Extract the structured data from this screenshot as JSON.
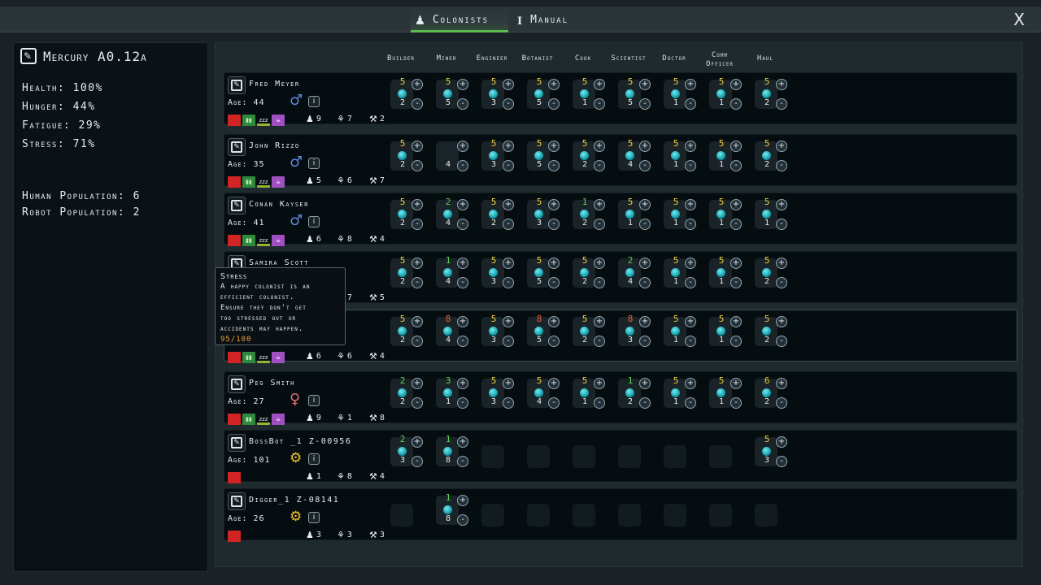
{
  "top": {
    "tabs": [
      {
        "label": "Colonists",
        "icon": "colonist-icon"
      },
      {
        "label": "Manual",
        "icon": "info-icon"
      }
    ],
    "close_label": "X"
  },
  "colony": {
    "name": "Mercury A0.12a",
    "health": "Health: 100%",
    "hunger": "Hunger: 44%",
    "fatigue": "Fatigue: 29%",
    "stress": "Stress: 71%",
    "human_population": "Human Population: 6",
    "robot_population": "Robot Population: 2"
  },
  "jobs": [
    "Builder",
    "Miner",
    "Engineer",
    "Botanist",
    "Cook",
    "Scientist",
    "Doctor",
    "Comm Officer",
    "Haul"
  ],
  "colonists": [
    {
      "name": "Fred Meyer",
      "age": "Age: 44",
      "gender": "♂",
      "gtype": "male",
      "stats": [
        "9",
        "7",
        "2"
      ],
      "skills": [
        [
          "5",
          "2",
          "y"
        ],
        [
          "5",
          "5",
          "y"
        ],
        [
          "5",
          "3",
          "y"
        ],
        [
          "5",
          "5",
          "y"
        ],
        [
          "5",
          "1",
          "y"
        ],
        [
          "5",
          "5",
          "y"
        ],
        [
          "5",
          "1",
          "y"
        ],
        [
          "5",
          "1",
          "y"
        ],
        [
          "5",
          "2",
          "y"
        ]
      ]
    },
    {
      "name": "John Rizzo",
      "age": "Age: 35",
      "gender": "♂",
      "gtype": "male",
      "stats": [
        "5",
        "6",
        "7"
      ],
      "skills": [
        [
          "5",
          "2",
          "y"
        ],
        [
          "",
          "4",
          "e"
        ],
        [
          "5",
          "3",
          "y"
        ],
        [
          "5",
          "5",
          "y"
        ],
        [
          "5",
          "2",
          "y"
        ],
        [
          "5",
          "4",
          "y"
        ],
        [
          "5",
          "1",
          "y"
        ],
        [
          "5",
          "1",
          "y"
        ],
        [
          "5",
          "2",
          "y"
        ]
      ]
    },
    {
      "name": "Conan Kayser",
      "age": "Age: 41",
      "gender": "♂",
      "gtype": "male",
      "stats": [
        "6",
        "8",
        "4"
      ],
      "skills": [
        [
          "5",
          "2",
          "y"
        ],
        [
          "2",
          "4",
          "g"
        ],
        [
          "5",
          "2",
          "y"
        ],
        [
          "5",
          "3",
          "y"
        ],
        [
          "1",
          "2",
          "g"
        ],
        [
          "5",
          "1",
          "y"
        ],
        [
          "5",
          "1",
          "y"
        ],
        [
          "5",
          "1",
          "y"
        ],
        [
          "5",
          "1",
          "y"
        ]
      ]
    },
    {
      "name": "Samira Scott",
      "age": "",
      "gender": "",
      "gtype": "none",
      "stats": [
        "",
        "7",
        "5"
      ],
      "skills": [
        [
          "5",
          "2",
          "y"
        ],
        [
          "1",
          "4",
          "g"
        ],
        [
          "5",
          "3",
          "y"
        ],
        [
          "5",
          "5",
          "y"
        ],
        [
          "5",
          "2",
          "y"
        ],
        [
          "2",
          "4",
          "g"
        ],
        [
          "5",
          "1",
          "y"
        ],
        [
          "5",
          "1",
          "y"
        ],
        [
          "5",
          "2",
          "y"
        ]
      ]
    },
    {
      "name": "",
      "age": "",
      "gender": "",
      "gtype": "none",
      "stats": [
        "6",
        "6",
        "4"
      ],
      "skills": [
        [
          "5",
          "2",
          "y"
        ],
        [
          "8",
          "4",
          "r"
        ],
        [
          "5",
          "3",
          "y"
        ],
        [
          "8",
          "5",
          "r"
        ],
        [
          "5",
          "2",
          "y"
        ],
        [
          "8",
          "3",
          "r"
        ],
        [
          "5",
          "1",
          "y"
        ],
        [
          "5",
          "1",
          "y"
        ],
        [
          "5",
          "2",
          "y"
        ]
      ]
    },
    {
      "name": "Peg Smith",
      "age": "Age: 27",
      "gender": "♀",
      "gtype": "female",
      "stats": [
        "9",
        "1",
        "8"
      ],
      "skills": [
        [
          "2",
          "2",
          "g"
        ],
        [
          "3",
          "1",
          "g"
        ],
        [
          "5",
          "3",
          "y"
        ],
        [
          "5",
          "4",
          "y"
        ],
        [
          "5",
          "1",
          "y"
        ],
        [
          "1",
          "2",
          "g"
        ],
        [
          "5",
          "1",
          "y"
        ],
        [
          "5",
          "1",
          "y"
        ],
        [
          "6",
          "2",
          "y"
        ]
      ]
    },
    {
      "name": "BossBot _1 Z-00956",
      "age": "Age: 101",
      "gender": "⚙",
      "gtype": "robot",
      "stats": [
        "1",
        "8",
        "4"
      ],
      "skills": [
        [
          "2",
          "3",
          "g"
        ],
        [
          "1",
          "8",
          "g"
        ],
        null,
        null,
        null,
        null,
        null,
        null,
        [
          "5",
          "3",
          "y"
        ]
      ]
    },
    {
      "name": "Digger_1 Z-08141",
      "age": "Age: 26",
      "gender": "⚙",
      "gtype": "robot",
      "stats": [
        "3",
        "3",
        "3"
      ],
      "skills": [
        null,
        [
          "1",
          "8",
          "g"
        ],
        null,
        null,
        null,
        null,
        null,
        null,
        null
      ]
    }
  ],
  "tooltip": {
    "title": "Stress",
    "lines": [
      "A happy colonist is an",
      "efficient colonist.",
      "Ensure they don't get",
      "too stressed out or",
      "accidents may happen."
    ],
    "value": "95/100"
  },
  "colors": {
    "accent_green": "#5dbb4f",
    "skill_yellow": "#f0d038",
    "skill_green": "#5bd34e",
    "skill_red": "#e8603a",
    "orb_cyan": "#1aaab4"
  }
}
